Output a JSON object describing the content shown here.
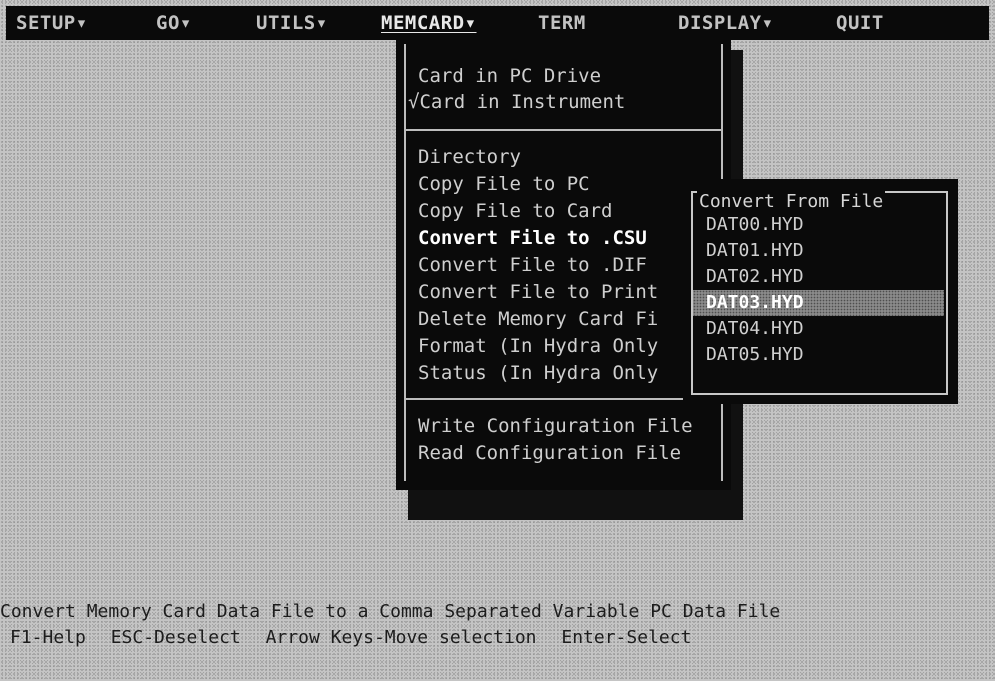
{
  "menubar": {
    "items": [
      "SETUP▾",
      "GO▾",
      "UTILS▾",
      "MEMCARD▾",
      "TERM",
      "DISPLAY▾",
      "QUIT"
    ],
    "active": "MEMCARD▾"
  },
  "memcard_menu": {
    "group1": [
      {
        "label": "Card in PC Drive",
        "checked": false
      },
      {
        "label": "√Card in Instrument",
        "checked": true
      }
    ],
    "group2": [
      "Directory",
      "Copy File to PC",
      "Copy File to Card",
      "Convert File to .CSU",
      "Convert File to .DIF",
      "Convert File to Print",
      "Delete Memory Card Fi",
      "Format (In Hydra Only",
      "Status (In Hydra Only"
    ],
    "highlighted": "Convert File to .CSU",
    "group3": [
      "Write Configuration File",
      "Read Configuration File"
    ]
  },
  "convert_submenu": {
    "title": "Convert From File",
    "files": [
      "DAT00.HYD",
      "DAT01.HYD",
      "DAT02.HYD",
      "DAT03.HYD",
      "DAT04.HYD",
      "DAT05.HYD"
    ],
    "selected": "DAT03.HYD"
  },
  "status": {
    "description": "Convert Memory Card Data File to a Comma Separated Variable PC Data File",
    "hints": [
      "F1-Help",
      "ESC-Deselect",
      "Arrow Keys-Move selection",
      "Enter-Select"
    ]
  }
}
